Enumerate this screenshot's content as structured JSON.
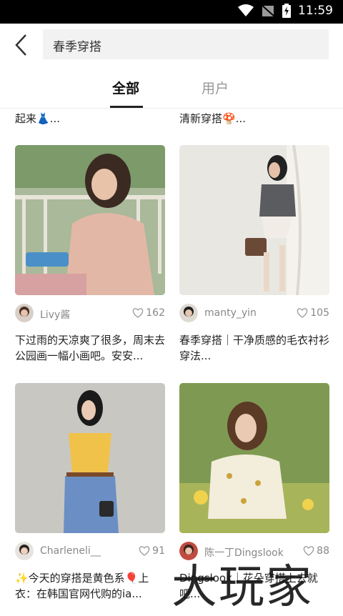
{
  "status_bar": {
    "time": "11:59"
  },
  "header": {
    "search_query": "春季穿搭"
  },
  "tabs": [
    {
      "label": "全部"
    },
    {
      "label": "用户"
    }
  ],
  "snippets": [
    {
      "text": "起来👗..."
    },
    {
      "text": "清新穿搭🍄..."
    }
  ],
  "posts": [
    {
      "author": "Livy酱",
      "likes": "162",
      "caption": "下过雨的天凉爽了很多，周末去公园画一幅小画吧。安安..."
    },
    {
      "author": "manty_yin",
      "likes": "105",
      "caption": "春季穿搭｜干净质感的毛衣衬衫穿法..."
    },
    {
      "author": "Charleneli__",
      "likes": "91",
      "caption": "✨今天的穿搭是黄色系🎈上衣：在韩国官网代购的ia..."
    },
    {
      "author": "陈一丁Dingslook",
      "likes": "88",
      "caption": "Dingslook｜花朵穿搭上去就吧..."
    }
  ],
  "watermark": {
    "logo_text": "大玩家"
  },
  "colors": {
    "status_bar": "#000000",
    "accent": "#222222",
    "muted": "#888888"
  }
}
